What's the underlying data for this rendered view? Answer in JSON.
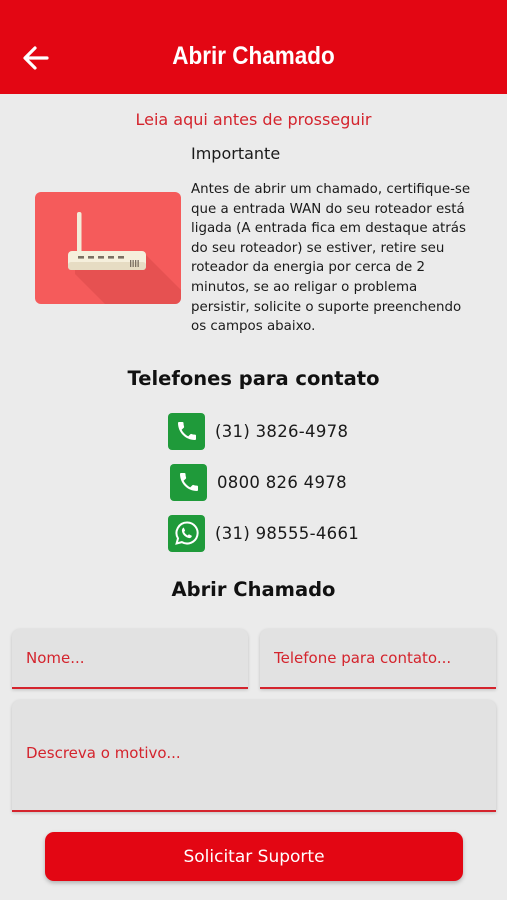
{
  "header": {
    "title": "Abrir Chamado",
    "back_icon": "arrow-left-icon"
  },
  "notice": {
    "link_text": "Leia aqui antes de prosseguir",
    "title": "Importante",
    "body": "Antes de abrir um chamado, certifique-se que a entrada WAN do seu roteador está ligada (A entrada fica em destaque atrás do seu roteador) se estiver, retire seu roteador da energia por cerca de 2 minutos, se ao religar o problema persistir, solicite o suporte preenchendo os campos abaixo.",
    "image_icon": "router-icon"
  },
  "contacts": {
    "title": "Telefones para contato",
    "items": [
      {
        "icon": "phone-icon",
        "number": "(31) 3826-4978"
      },
      {
        "icon": "phone-icon",
        "number": "0800 826 4978"
      },
      {
        "icon": "whatsapp-icon",
        "number": "(31) 98555-4661"
      }
    ]
  },
  "form": {
    "title": "Abrir Chamado",
    "name_placeholder": "Nome...",
    "phone_placeholder": "Telefone para contato...",
    "reason_placeholder": "Descreva o motivo...",
    "submit_label": "Solicitar Suporte"
  },
  "colors": {
    "primary": "#e30613",
    "accent_text": "#d4242d",
    "contact_green": "#1f9a3a",
    "background": "#ebebeb",
    "router_card": "#f55b5b"
  }
}
